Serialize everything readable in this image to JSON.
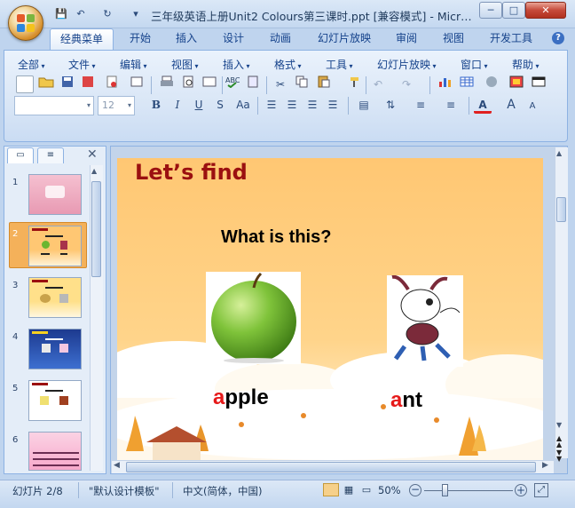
{
  "window": {
    "title": "三年级英语上册Unit2 Colours第三课时.ppt [兼容模式] - Micr…"
  },
  "quick_access": {
    "save": "💾",
    "undo": "↶",
    "redo": "↻",
    "customize": "▾"
  },
  "window_controls": {
    "minimize": "─",
    "maximize": "□",
    "close": "✕"
  },
  "ribbon_tabs": [
    "经典菜单",
    "开始",
    "插入",
    "设计",
    "动画",
    "幻灯片放映",
    "审阅",
    "视图",
    "开发工具"
  ],
  "help": "?",
  "menus": [
    "全部",
    "文件",
    "编辑",
    "视图",
    "插入",
    "格式",
    "工具",
    "幻灯片放映",
    "窗口",
    "帮助"
  ],
  "toolbar": {
    "font_name": "",
    "font_size": "12",
    "bold": "B",
    "italic": "I",
    "underline": "U",
    "strike": "S",
    "case": "Aa",
    "font_color": "A",
    "grow": "A",
    "shrink": "A"
  },
  "slides_panel": {
    "numbers": [
      "1",
      "2",
      "3",
      "4",
      "5",
      "6"
    ],
    "selected_index": 2
  },
  "slide": {
    "title": "Let’s find",
    "question": "What is this?",
    "word1_first": "a",
    "word1_rest": "pple",
    "word2_first": "a",
    "word2_rest": "nt"
  },
  "status": {
    "slide_index": "幻灯片 2/8",
    "theme": "\"默认设计模板\"",
    "language": "中文(简体，中国)",
    "zoom": "50%",
    "zoom_level_percent": 50
  },
  "colors": {
    "title_red": "#9b1010",
    "accent_red": "#e61a1a",
    "slide_bg": "#ffc773"
  }
}
